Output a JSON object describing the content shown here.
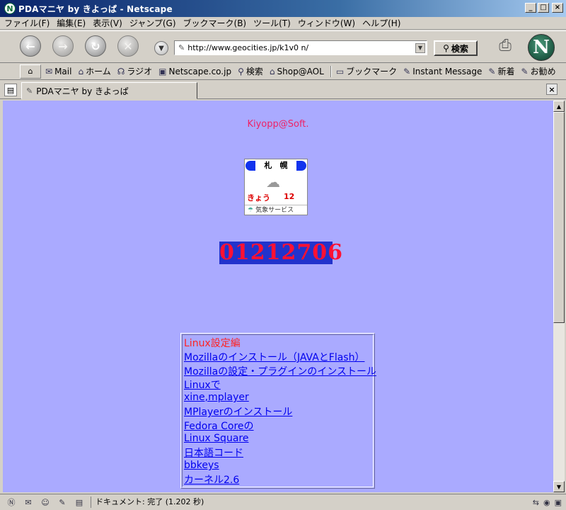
{
  "window": {
    "title": "PDAマニヤ by きよっぱ - Netscape",
    "app_icon_letter": "N",
    "buttons": {
      "minimize": "_",
      "maximize": "□",
      "close": "×"
    }
  },
  "menu": [
    "ファイル(F)",
    "編集(E)",
    "表示(V)",
    "ジャンプ(G)",
    "ブックマーク(B)",
    "ツール(T)",
    "ウィンドウ(W)",
    "ヘルプ(H)"
  ],
  "navigation": {
    "url": "http://www.geocities.jp/k1v0 n/",
    "search_label": "検索",
    "logo_letter": "N"
  },
  "personal_toolbar": [
    {
      "icon": "mail-icon",
      "glyph": "✉",
      "label": "Mail"
    },
    {
      "icon": "home-icon",
      "glyph": "⌂",
      "label": "ホーム"
    },
    {
      "icon": "radio-icon",
      "glyph": "☊",
      "label": "ラジオ"
    },
    {
      "icon": "my-icon",
      "glyph": "▣",
      "label": "Netscape.co.jp"
    },
    {
      "icon": "search-icon",
      "glyph": "⚲",
      "label": "検索"
    },
    {
      "icon": "shop-icon",
      "glyph": "⌂",
      "label": "Shop@AOL"
    },
    {
      "icon": "folder-icon",
      "glyph": "▭",
      "label": "ブックマーク"
    },
    {
      "icon": "bookmark-icon",
      "glyph": "✎",
      "label": "Instant Message"
    },
    {
      "icon": "bookmark-icon",
      "glyph": "✎",
      "label": "新着"
    },
    {
      "icon": "bookmark-icon",
      "glyph": "✎",
      "label": "お勧め"
    }
  ],
  "tab": {
    "label": "PDAマニヤ by きよっぱ",
    "close": "×"
  },
  "page": {
    "site_name": "Kiyopp@Soft.",
    "weather": {
      "city": "札　幌",
      "day": "きょう",
      "temp": "12",
      "footer": "気象サービス"
    },
    "counter": "01212706",
    "links_heading": "Linux設定編",
    "links": [
      "Mozillaのインストール（JAVAとFlash）",
      "Mozillaの設定・プラグインのインストール",
      "Linuxで",
      "xine,mplayer",
      "MPlayerのインストール",
      "Fedora Coreの",
      "Linux Square",
      "日本語コード",
      "bbkeys",
      "カーネル2.6"
    ]
  },
  "status": {
    "text": "ドキュメント: 完了 (1.202 秒)"
  }
}
